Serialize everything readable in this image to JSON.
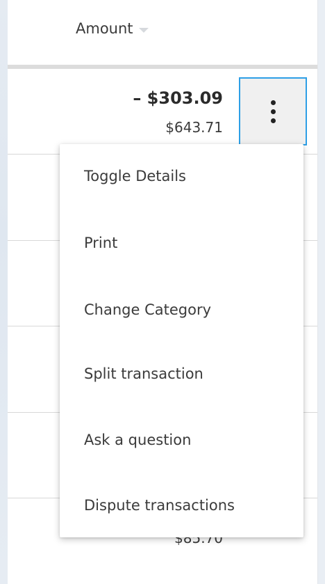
{
  "table": {
    "column_header": "Amount",
    "sort_icon": "caret-down-icon"
  },
  "transaction": {
    "amount": "– $303.09",
    "balance": "$643.71",
    "menu_icon": "kebab-vertical-icon"
  },
  "next_transaction": {
    "balance": "$85.70",
    "menu_icon": "kebab-vertical-icon"
  },
  "context_menu": {
    "items": [
      {
        "label": "Toggle Details"
      },
      {
        "label": "Print"
      },
      {
        "label": "Change Category"
      },
      {
        "label": "Split transaction"
      },
      {
        "label": "Ask a question"
      },
      {
        "label": "Dispute transactions"
      }
    ]
  },
  "colors": {
    "focus_border": "#2d9fe6",
    "text_primary": "#2b2b2b",
    "divider": "#d8d8d8"
  }
}
